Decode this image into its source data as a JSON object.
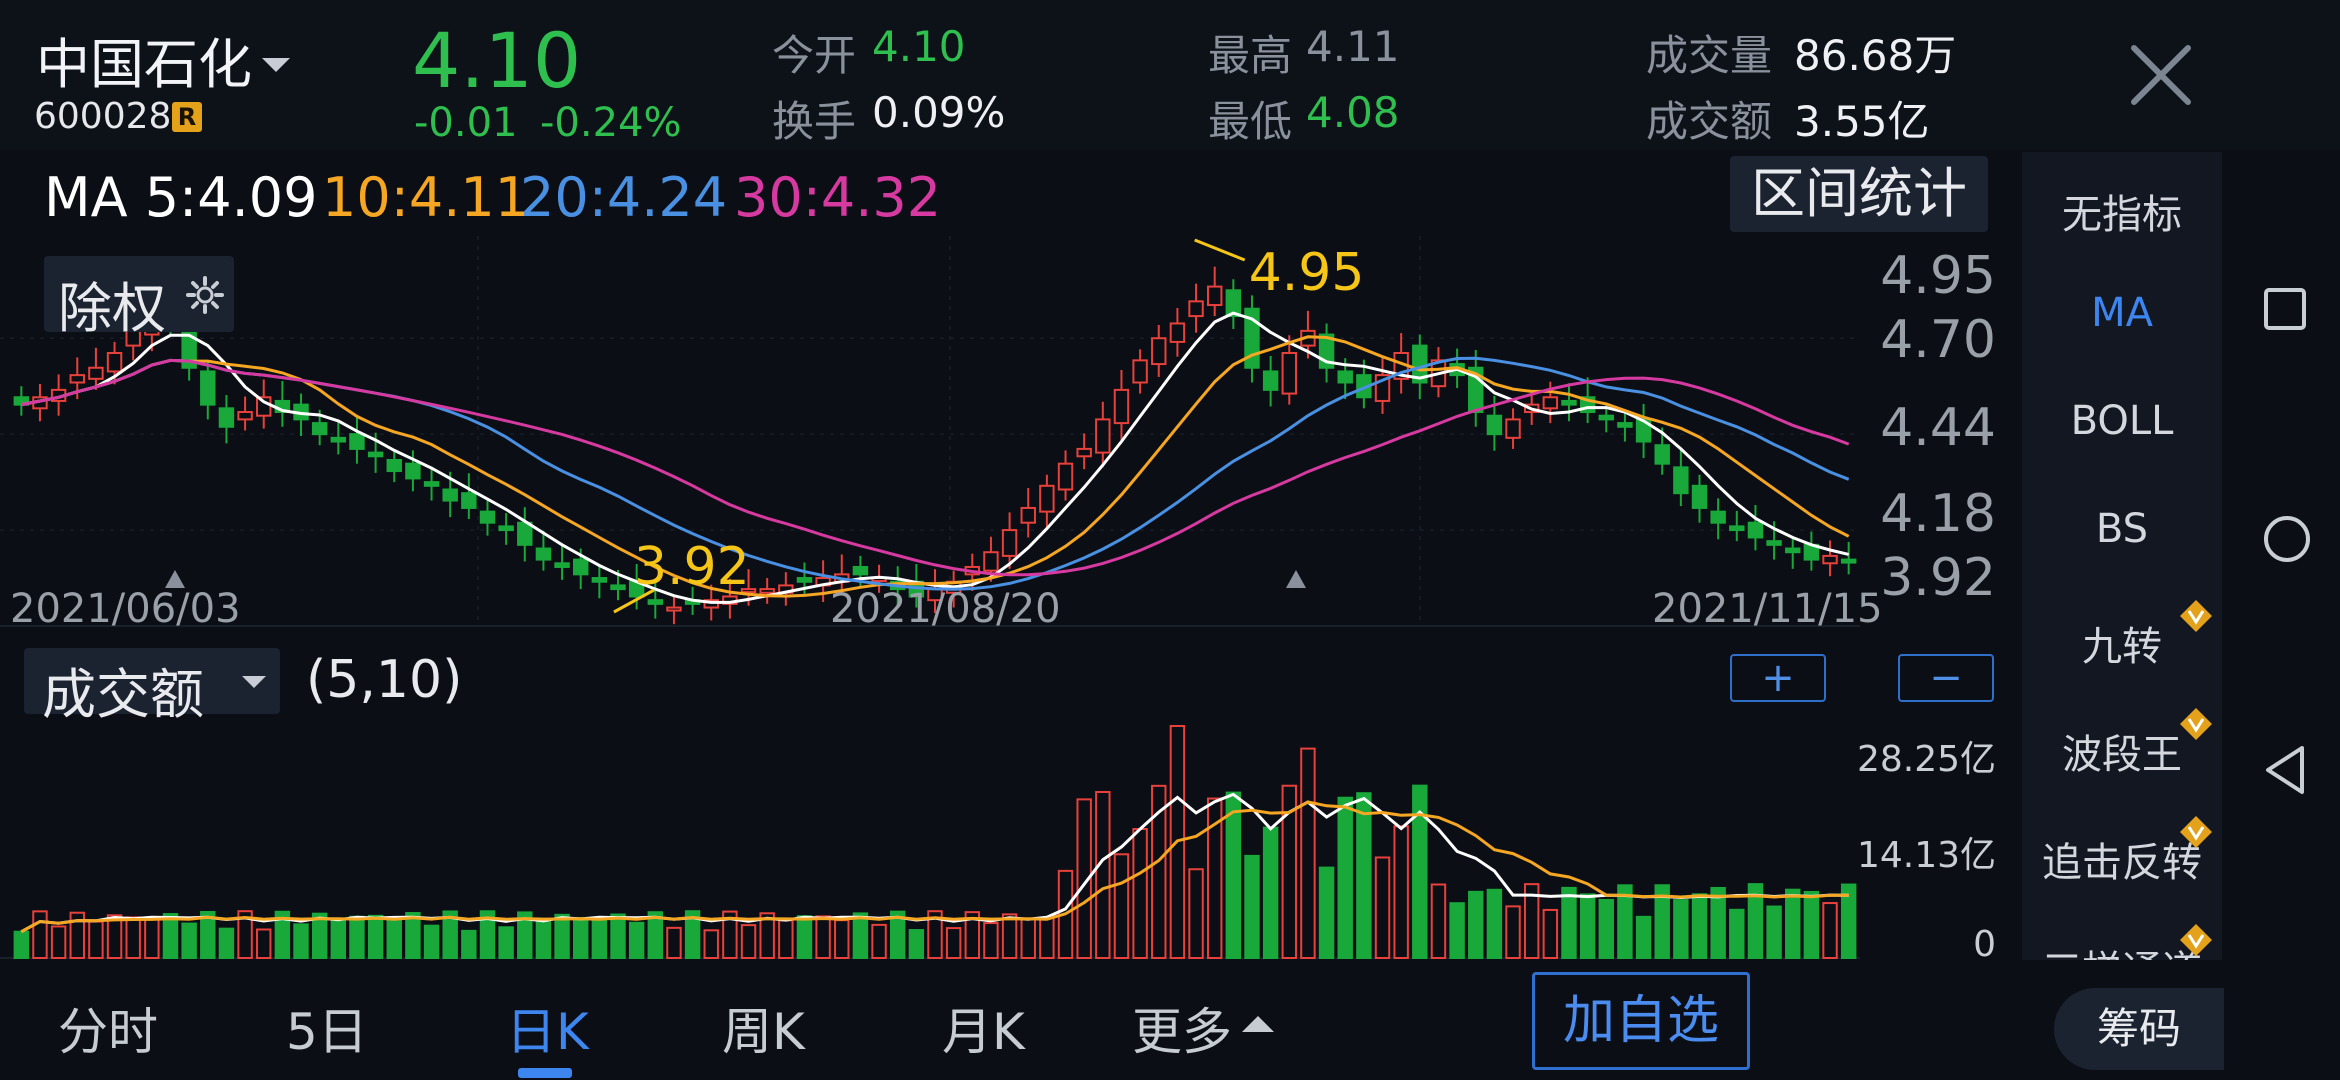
{
  "stock": {
    "name": "中国石化",
    "code": "600028",
    "r_badge": "R",
    "price": "4.10",
    "change": "-0.01",
    "change_pct": "-0.24%"
  },
  "quote": {
    "open_label": "今开",
    "open": "4.10",
    "turnover_label": "换手",
    "turnover": "0.09%",
    "high_label": "最高",
    "high": "4.11",
    "low_label": "最低",
    "low": "4.08",
    "volume_label": "成交量",
    "volume": "86.68万",
    "amount_label": "成交额",
    "amount": "3.55亿"
  },
  "ma": {
    "ma5": "MA 5:4.09",
    "ma10": "10:4.11",
    "ma20": "20:4.24",
    "ma30": "30:4.32"
  },
  "buttons": {
    "interval_stats": "区间统计",
    "ex_rights": "除权",
    "plus": "+",
    "minus": "−",
    "add_watchlist": "加自选",
    "chips": "筹码"
  },
  "kline": {
    "y_ticks": [
      "4.95",
      "4.70",
      "4.44",
      "4.18",
      "3.92"
    ],
    "dates": [
      "2021/06/03",
      "2021/08/20",
      "2021/11/15"
    ],
    "high_mark": "4.95",
    "low_mark": "3.92"
  },
  "volume_panel": {
    "indicator": "成交额",
    "params": "(5,10)",
    "ticks": [
      "28.25亿",
      "14.13亿",
      "0"
    ]
  },
  "sidebar": {
    "items": [
      "无指标",
      "MA",
      "BOLL",
      "BS",
      "九转",
      "波段王",
      "追击反转",
      "三梯通道"
    ],
    "active": "MA"
  },
  "tabs": [
    "分时",
    "5日",
    "日K",
    "周K",
    "月K",
    "更多"
  ],
  "active_tab": "日K",
  "colors": {
    "up": "#e8413c",
    "down": "#19a83a",
    "ma5": "#ffffff",
    "ma10": "#f5a623",
    "ma20": "#4a90e2",
    "ma30": "#d63aa0",
    "accent": "#3d86f0",
    "price_green": "#2fbf4f"
  },
  "chart_data": {
    "type": "candlestick",
    "y_range": [
      3.92,
      4.95
    ],
    "close": [
      4.52,
      4.54,
      4.56,
      4.6,
      4.62,
      4.66,
      4.72,
      4.8,
      4.74,
      4.62,
      4.52,
      4.46,
      4.5,
      4.54,
      4.5,
      4.48,
      4.44,
      4.42,
      4.4,
      4.38,
      4.34,
      4.32,
      4.3,
      4.26,
      4.24,
      4.2,
      4.18,
      4.14,
      4.1,
      4.08,
      4.06,
      4.04,
      4.02,
      4.0,
      3.98,
      3.97,
      3.98,
      3.99,
      4.0,
      4.02,
      4.02,
      4.03,
      4.04,
      4.05,
      4.06,
      4.06,
      4.05,
      4.02,
      4.0,
      4.02,
      4.04,
      4.08,
      4.12,
      4.18,
      4.24,
      4.3,
      4.36,
      4.4,
      4.48,
      4.56,
      4.64,
      4.7,
      4.74,
      4.8,
      4.84,
      4.76,
      4.62,
      4.56,
      4.66,
      4.72,
      4.62,
      4.58,
      4.54,
      4.6,
      4.66,
      4.58,
      4.64,
      4.6,
      4.5,
      4.44,
      4.48,
      4.52,
      4.54,
      4.52,
      4.5,
      4.48,
      4.46,
      4.42,
      4.36,
      4.28,
      4.24,
      4.2,
      4.18,
      4.16,
      4.14,
      4.12,
      4.1,
      4.11,
      4.1
    ],
    "volume_ma": [
      5.1,
      9.8
    ]
  }
}
